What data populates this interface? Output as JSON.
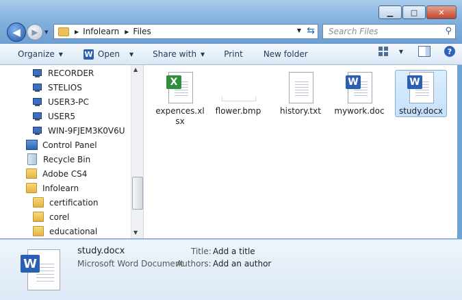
{
  "window": {
    "minimize_glyph": "▁",
    "maximize_glyph": "□",
    "close_glyph": "✕"
  },
  "nav": {
    "back_glyph": "◀",
    "forward_glyph": "▶",
    "breadcrumb": [
      "Infolearn",
      "Files"
    ],
    "search_placeholder": "Search Files"
  },
  "toolbar": {
    "organize": "Organize",
    "open": "Open",
    "share_with": "Share with",
    "print": "Print",
    "new_folder": "New folder",
    "help": "?"
  },
  "tree": {
    "computers": [
      "RECORDER",
      "STELIOS",
      "USER3-PC",
      "USER5",
      "WIN-9FJEM3K0V6U"
    ],
    "control_panel": "Control Panel",
    "recycle_bin": "Recycle Bin",
    "folders": [
      "Adobe CS4",
      "Infolearn"
    ],
    "subfolders": [
      "certification",
      "corel",
      "educational"
    ]
  },
  "files": [
    {
      "name": "expences.xlsx",
      "kind": "excel",
      "selected": false
    },
    {
      "name": "flower.bmp",
      "kind": "bmp",
      "selected": false
    },
    {
      "name": "history.txt",
      "kind": "text",
      "selected": false
    },
    {
      "name": "mywork.doc",
      "kind": "word",
      "selected": false
    },
    {
      "name": "study.docx",
      "kind": "word",
      "selected": true
    }
  ],
  "details": {
    "name": "study.docx",
    "type": "Microsoft Word Document",
    "title_label": "Title:",
    "title_value": "Add a title",
    "authors_label": "Authors:",
    "authors_value": "Add an author"
  },
  "colors": {
    "frame": "#84b2dd",
    "selection": "#c4e0fb",
    "excel": "#2f8d3d",
    "word": "#2b5fb3"
  }
}
